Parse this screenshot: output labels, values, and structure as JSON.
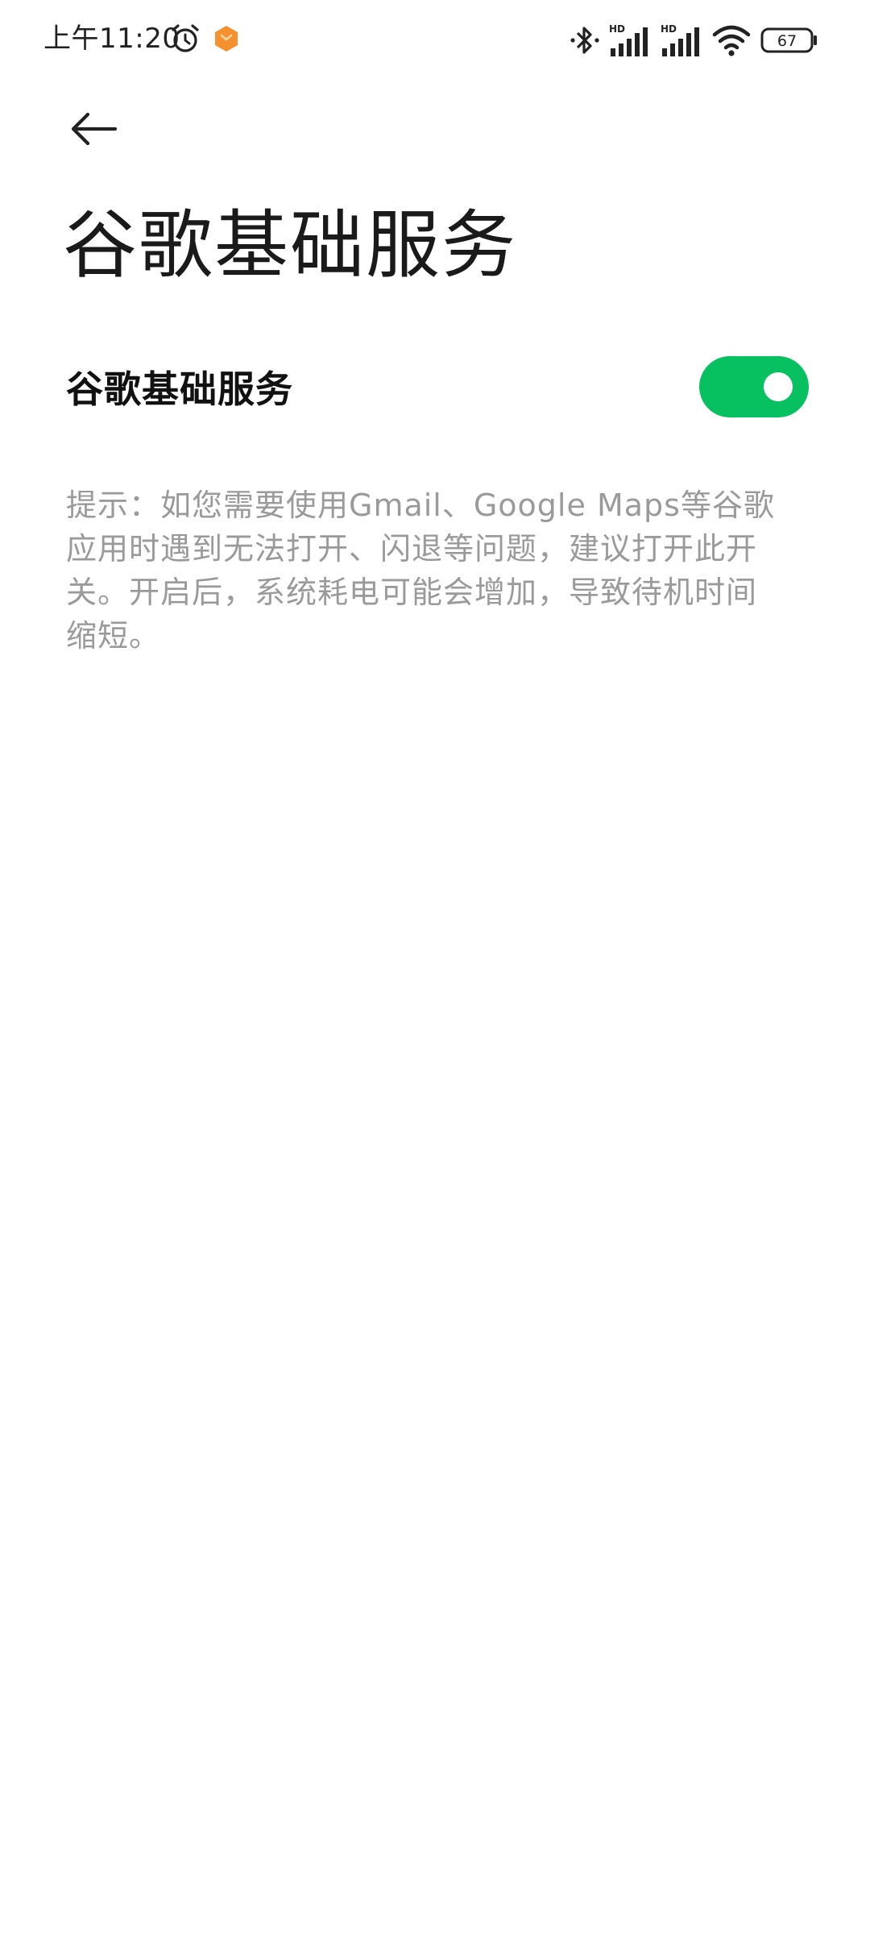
{
  "status_bar": {
    "time": "上午11:20",
    "battery_level": "67",
    "signal_1_label": "HD",
    "signal_2_label": "HD",
    "icons": [
      "alarm-icon",
      "app-badge-icon",
      "bluetooth-icon",
      "signal-hd-icon",
      "signal-hd-icon",
      "wifi-icon",
      "battery-icon"
    ]
  },
  "header": {
    "back_icon": "arrow-left-icon",
    "title": "谷歌基础服务"
  },
  "setting": {
    "label": "谷歌基础服务",
    "enabled": true,
    "accent_color": "#07c160"
  },
  "hint": {
    "text": "提示：如您需要使用Gmail、Google Maps等谷歌应用时遇到无法打开、闪退等问题，建议打开此开关。开启后，系统耗电可能会增加，导致待机时间缩短。"
  }
}
